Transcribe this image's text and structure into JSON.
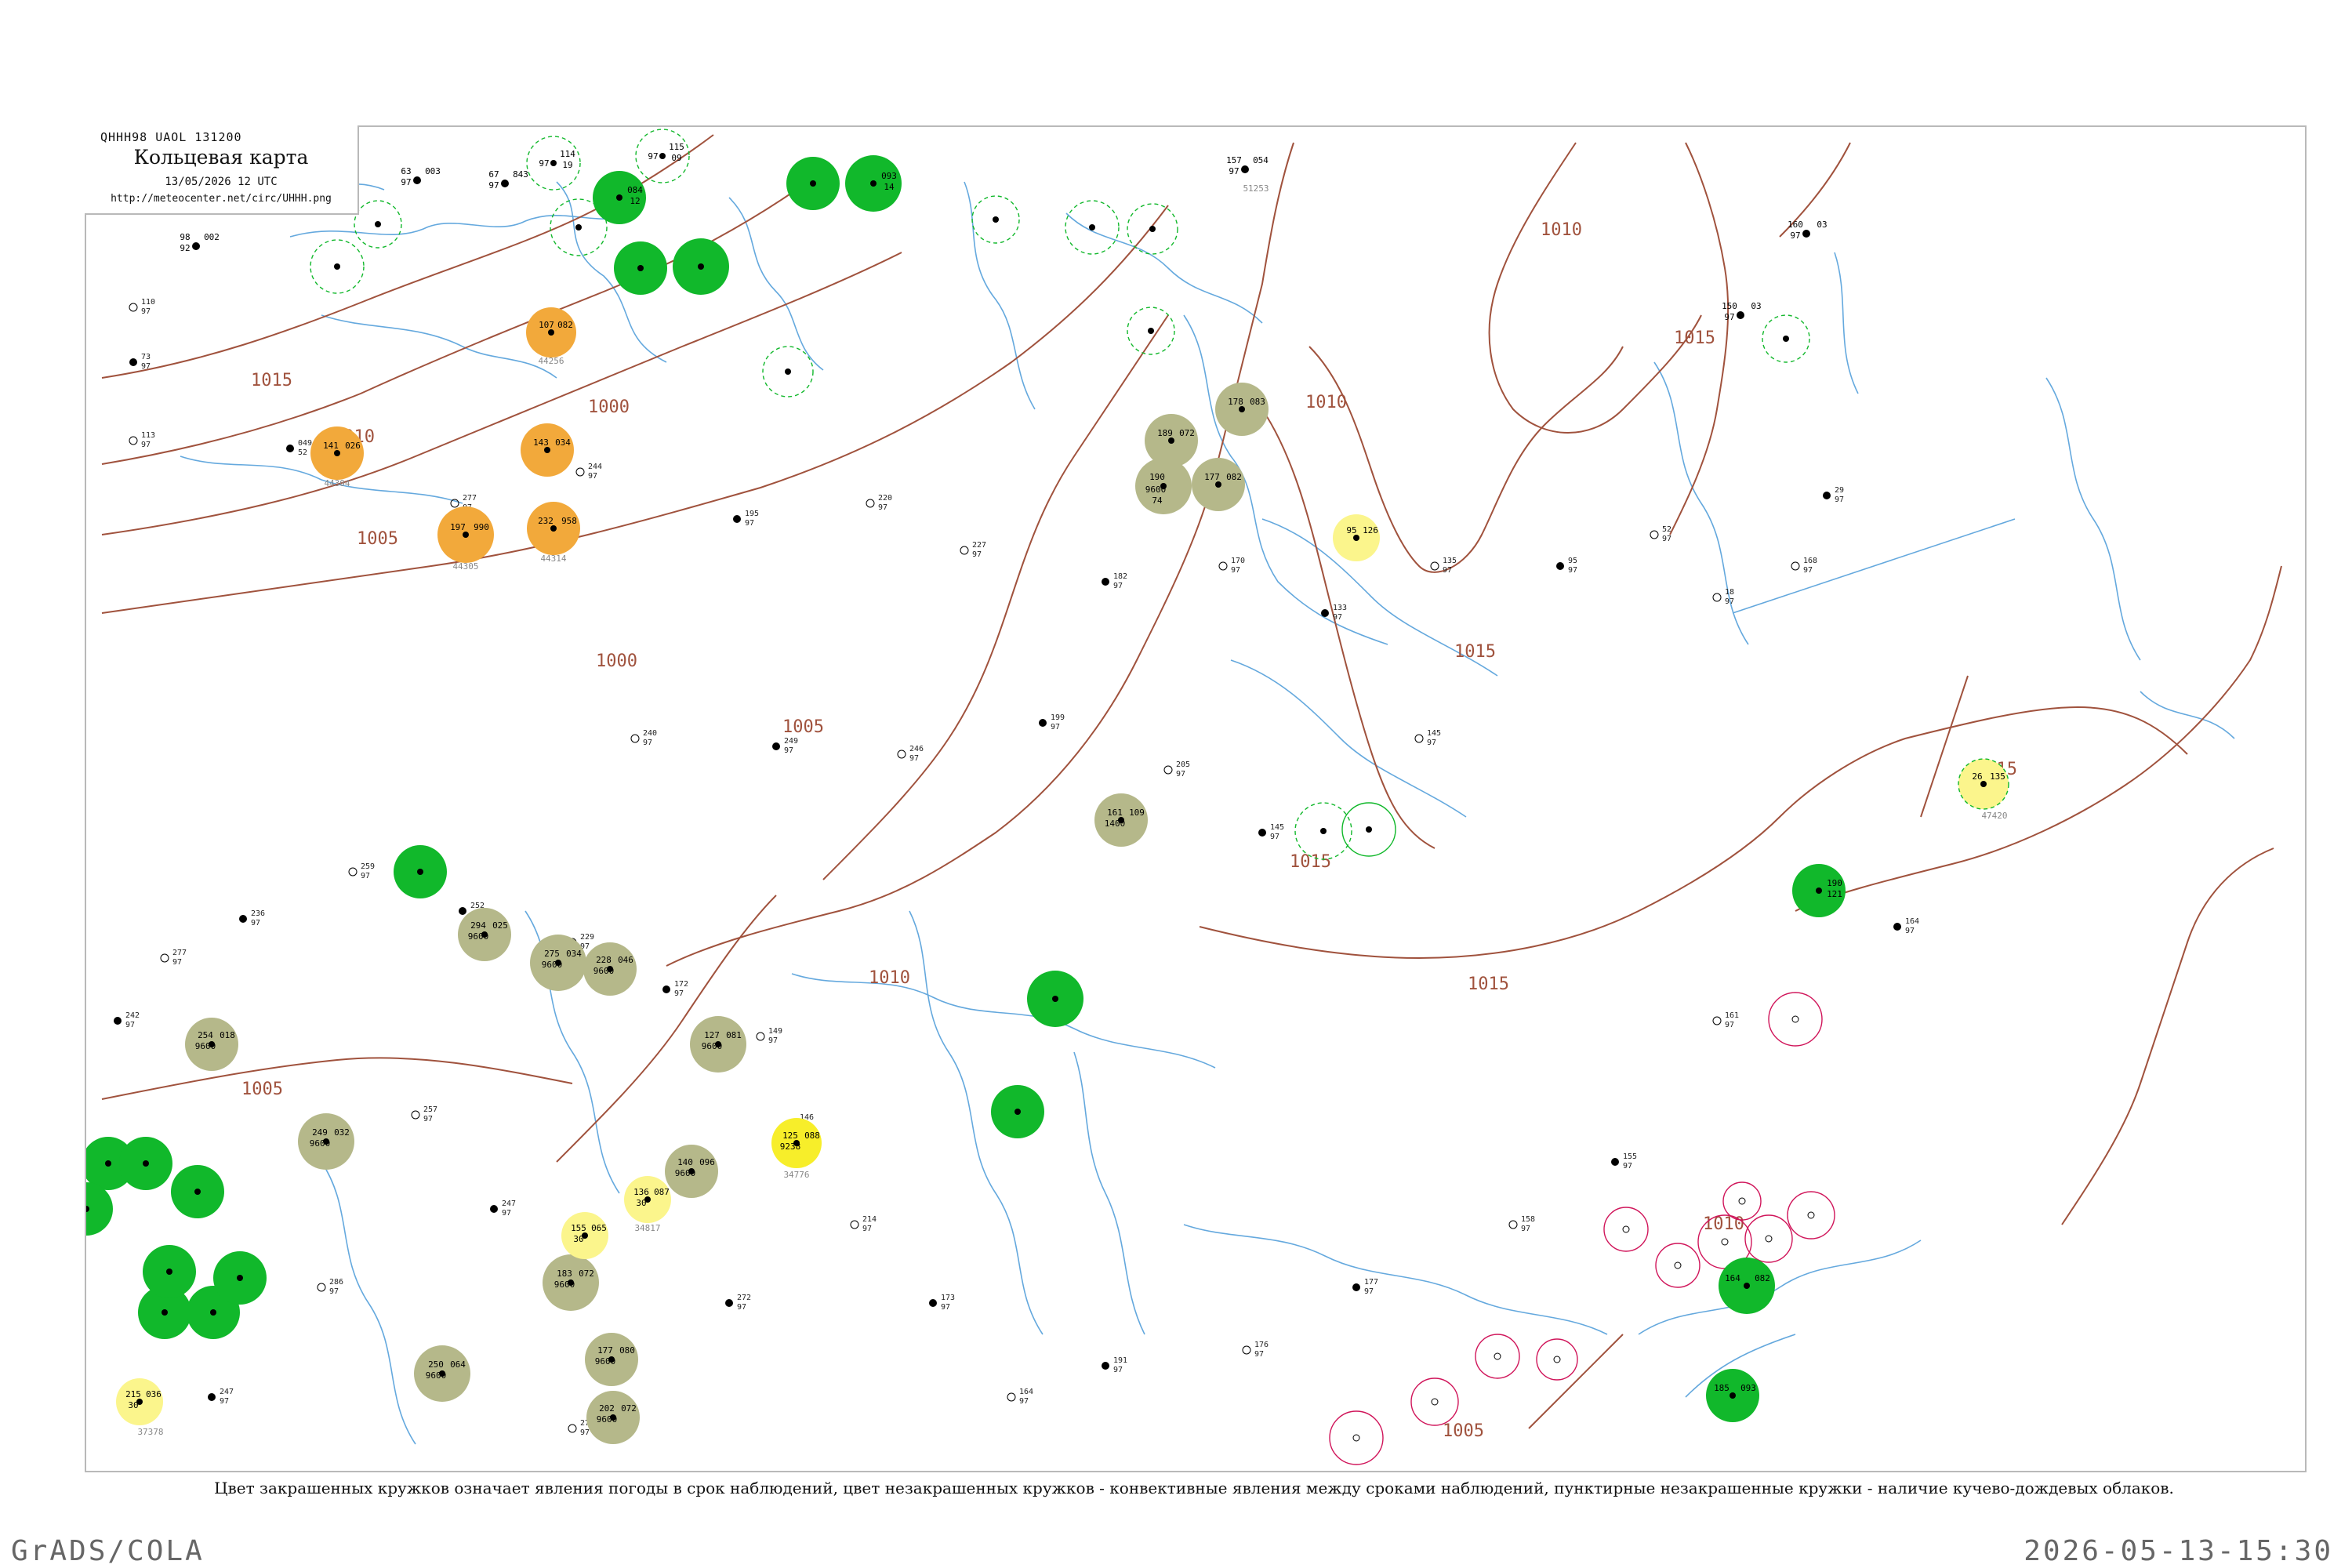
{
  "header": {
    "code": "QHHH98  UAOL  131200",
    "title": "Кольцевая карта",
    "date": "13/05/2026 12 UTC",
    "url": "http://meteocenter.net/circ/UHHH.png"
  },
  "caption": "Цвет закрашенных кружков означает явления погоды в срок наблюдений, цвет незакрашенных кружков - конвективные явления между сроками наблюдений, пунктирные незакрашенные кружки - наличие кучево-дождевых облаков.",
  "footer": {
    "left": "GrADS/COLA",
    "right": "2026-05-13-15:30"
  },
  "colors": {
    "rain": "#11b82b",
    "drizzle_olive": "#b5b88a",
    "haze_orange": "#f2a93b",
    "light_yellow": "#fbf58c",
    "yellow": "#f7ee2a",
    "cb_dashed": "#11b82b",
    "thunder_ring": "#d0155a",
    "isobar": "#a0523d",
    "river": "#4a9ad8",
    "station_id": "#888888"
  },
  "isobars": [
    "1015",
    "1010",
    "1005",
    "1000",
    "1005",
    "1000",
    "1005",
    "1010",
    "1015",
    "1010",
    "1015",
    "1010",
    "1015",
    "1015",
    "1015",
    "1010",
    "1005"
  ],
  "stations": [
    {
      "t": "98",
      "p": "002",
      "v": "92",
      "id": "",
      "kind": "plain"
    },
    {
      "t": "63",
      "p": "003",
      "v": "97",
      "id": "",
      "kind": "plain"
    },
    {
      "t": "67",
      "p": "843",
      "v": "97",
      "id": "",
      "kind": "plain"
    },
    {
      "t": "114",
      "p": "19",
      "v": "97",
      "id": "",
      "kind": "cb"
    },
    {
      "t": "115",
      "p": "09",
      "v": "97",
      "id": "",
      "kind": "cb"
    },
    {
      "t": "084",
      "p": "12",
      "v": "95",
      "id": "",
      "kind": "rain"
    },
    {
      "t": "093",
      "p": "14",
      "v": "97",
      "id": "",
      "kind": "rain"
    },
    {
      "t": "157",
      "p": "054",
      "v": "97",
      "id": "51253",
      "kind": "plain"
    },
    {
      "t": "150",
      "p": "03",
      "v": "97",
      "id": "",
      "kind": "plain"
    },
    {
      "t": "160",
      "p": "03",
      "v": "97",
      "id": "",
      "kind": "plain"
    },
    {
      "t": "107",
      "p": "082",
      "v": "97",
      "id": "44256",
      "kind": "haze"
    },
    {
      "t": "141",
      "p": "026",
      "v": "97",
      "id": "44304",
      "kind": "haze"
    },
    {
      "t": "143",
      "p": "034",
      "v": "96",
      "id": "",
      "kind": "haze"
    },
    {
      "t": "197",
      "p": "990",
      "v": "97",
      "id": "44305",
      "kind": "haze"
    },
    {
      "t": "232",
      "p": "958",
      "v": "97",
      "id": "44314",
      "kind": "haze"
    },
    {
      "t": "178",
      "p": "083",
      "v": "97",
      "id": "",
      "kind": "drizzle"
    },
    {
      "t": "189",
      "p": "072",
      "v": "97",
      "id": "",
      "kind": "drizzle"
    },
    {
      "t": "190",
      "p": "9600",
      "v": "74",
      "id": "",
      "kind": "drizzle"
    },
    {
      "t": "177",
      "p": "082",
      "v": "97",
      "id": "",
      "kind": "drizzle"
    },
    {
      "t": "95",
      "p": "126",
      "v": "95",
      "id": "",
      "kind": "lightyellow"
    },
    {
      "t": "161",
      "p": "109",
      "v": "1400",
      "id": "",
      "kind": "drizzle"
    },
    {
      "t": "26",
      "p": "135",
      "v": "96",
      "id": "47420",
      "kind": "lightyellow"
    },
    {
      "t": "190",
      "p": "121",
      "v": "97",
      "id": "",
      "kind": "rain"
    },
    {
      "t": "294",
      "p": "025",
      "v": "9600",
      "id": "",
      "kind": "drizzle"
    },
    {
      "t": "275",
      "p": "034",
      "v": "9600",
      "id": "",
      "kind": "drizzle"
    },
    {
      "t": "228",
      "p": "046",
      "v": "9600",
      "id": "",
      "kind": "drizzle"
    },
    {
      "t": "127",
      "p": "081",
      "v": "9600",
      "id": "",
      "kind": "drizzle"
    },
    {
      "t": "254",
      "p": "018",
      "v": "9600",
      "id": "",
      "kind": "drizzle"
    },
    {
      "t": "249",
      "p": "032",
      "v": "9600",
      "id": "",
      "kind": "drizzle"
    },
    {
      "t": "140",
      "p": "096",
      "v": "9600",
      "id": "",
      "kind": "drizzle"
    },
    {
      "t": "125",
      "p": "088",
      "v": "9238",
      "id": "34776",
      "kind": "yellow"
    },
    {
      "t": "136",
      "p": "087",
      "v": "30",
      "id": "34817",
      "kind": "lightyellow"
    },
    {
      "t": "155",
      "p": "065",
      "v": "30",
      "id": "",
      "kind": "lightyellow"
    },
    {
      "t": "183",
      "p": "072",
      "v": "9600",
      "id": "",
      "kind": "drizzle"
    },
    {
      "t": "177",
      "p": "080",
      "v": "9600",
      "id": "",
      "kind": "drizzle"
    },
    {
      "t": "250",
      "p": "064",
      "v": "9600",
      "id": "",
      "kind": "drizzle"
    },
    {
      "t": "202",
      "p": "072",
      "v": "9600",
      "id": "",
      "kind": "drizzle"
    },
    {
      "t": "215",
      "p": "036",
      "v": "30",
      "id": "37378",
      "kind": "lightyellow"
    },
    {
      "t": "164",
      "p": "082",
      "v": "97",
      "id": "",
      "kind": "rain"
    },
    {
      "t": "185",
      "p": "093",
      "v": "97",
      "id": "",
      "kind": "rain"
    }
  ]
}
